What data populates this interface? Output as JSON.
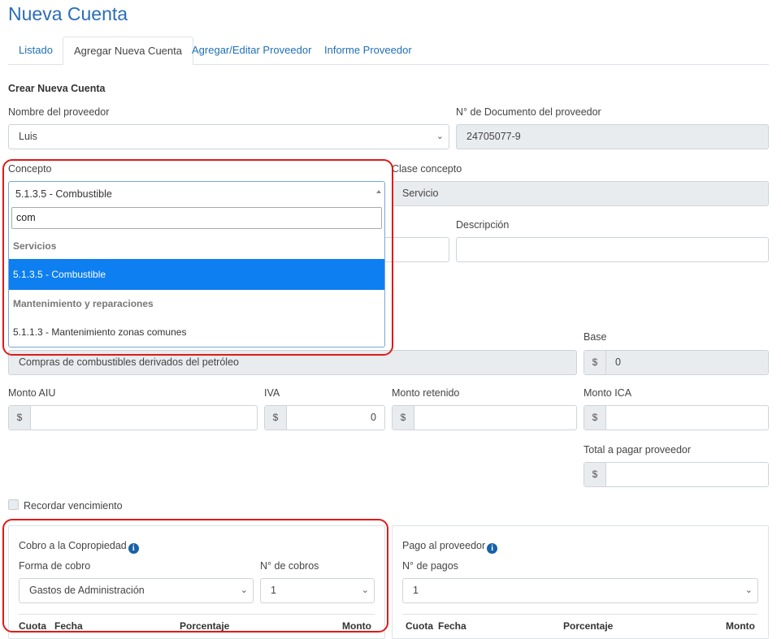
{
  "page_title": "Nueva Cuenta",
  "tabs": [
    {
      "label": "Listado"
    },
    {
      "label": "Agregar Nueva Cuenta"
    },
    {
      "label": "Agregar/Editar Proveedor"
    },
    {
      "label": "Informe Proveedor"
    }
  ],
  "section_title": "Crear Nueva Cuenta",
  "proveedor": {
    "label": "Nombre del proveedor",
    "value": "Luis"
  },
  "documento": {
    "label": "N° de Documento del proveedor",
    "value": "24705077-9"
  },
  "concepto": {
    "label": "Concepto",
    "value": "5.1.3.5 - Combustible",
    "search": "com",
    "groups": [
      {
        "label": "Servicios",
        "options": [
          {
            "label": "5.1.3.5 - Combustible",
            "selected": true
          }
        ]
      },
      {
        "label": "Mantenimiento y reparaciones",
        "options": [
          {
            "label": "5.1.1.3 - Mantenimiento zonas comunes",
            "selected": false
          }
        ]
      }
    ]
  },
  "clase_concepto": {
    "label": "Clase concepto",
    "value": "Servicio"
  },
  "descripcion": {
    "label": "Descripción",
    "value": ""
  },
  "concepto_desc": {
    "value": "Compras de combustibles derivados del petróleo"
  },
  "base": {
    "label": "Base",
    "currency": "$",
    "value": "0"
  },
  "monto_aiu": {
    "label": "Monto AIU",
    "currency": "$",
    "value": ""
  },
  "iva": {
    "label": "IVA",
    "currency": "$",
    "value": "0"
  },
  "monto_retenido": {
    "label": "Monto retenido",
    "currency": "$",
    "value": ""
  },
  "monto_ica": {
    "label": "Monto ICA",
    "currency": "$",
    "value": ""
  },
  "total": {
    "label": "Total a pagar proveedor",
    "currency": "$",
    "value": ""
  },
  "recordar": {
    "label": "Recordar vencimiento",
    "checked": false
  },
  "cobro": {
    "title": "Cobro a la Copropiedad",
    "forma_label": "Forma de cobro",
    "forma_value": "Gastos de Administración",
    "n_label": "N° de cobros",
    "n_value": "1",
    "columns": [
      "Cuota",
      "Fecha",
      "Porcentaje",
      "Monto"
    ]
  },
  "pago": {
    "title": "Pago al proveedor",
    "n_label": "N° de pagos",
    "n_value": "1",
    "columns": [
      "Cuota",
      "Fecha",
      "Porcentaje",
      "Monto"
    ]
  },
  "colors": {
    "accent": "#2a6db5",
    "highlight": "#e01a1a",
    "selected": "#0d7ff0"
  },
  "icons": [
    "chevron-down-icon",
    "info-icon",
    "caret-up-icon"
  ]
}
